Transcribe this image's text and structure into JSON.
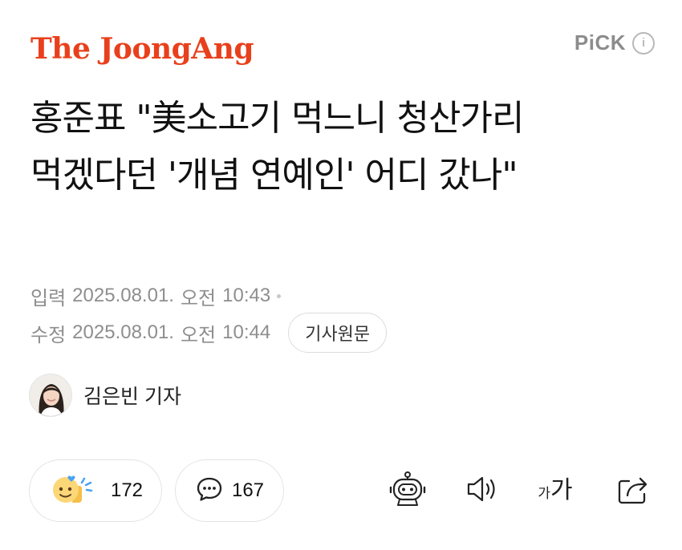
{
  "header": {
    "logo_text": "The JoongAng",
    "logo_color": "#e8401c",
    "pick_label": "PiCK",
    "pick_color": "#8c8c8c",
    "info_icon": "info-icon",
    "info_glyph": "i"
  },
  "article": {
    "title": "홍준표 \"美소고기 먹느니 청산가리 먹겠다던 '개념 연예인' 어디 갔나\"",
    "input_label": "입력",
    "input_date": "2025.08.01.",
    "input_ampm": "오전",
    "input_time": "10:43",
    "modified_label": "수정",
    "modified_date": "2025.08.01.",
    "modified_ampm": "오전",
    "modified_time": "10:44",
    "original_button": "기사원문"
  },
  "reporter": {
    "name": "김은빈 기자",
    "avatar_icon": "reporter-avatar"
  },
  "actions": {
    "reaction_icon": "emoji-reaction-icon",
    "reaction_count": "172",
    "comment_icon": "comment-bubble-icon",
    "comment_count": "167",
    "summary_icon": "robot-icon",
    "listen_icon": "speaker-icon",
    "font_size_small": "가",
    "font_size_big": "가",
    "share_icon": "share-icon"
  }
}
